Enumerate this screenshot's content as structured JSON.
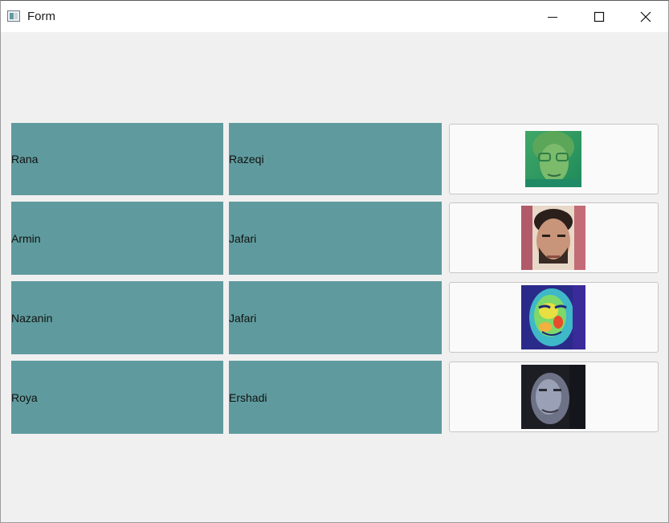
{
  "window": {
    "title": "Form",
    "icon": "app-window-icon",
    "controls": [
      "minimize-icon",
      "maximize-icon",
      "close-icon"
    ]
  },
  "rows": [
    {
      "first_name": "Rana",
      "last_name": "Razeqi",
      "photo_icon": "face-photo-green"
    },
    {
      "first_name": "Armin",
      "last_name": "Jafari",
      "photo_icon": "face-photo-natural"
    },
    {
      "first_name": "Nazanin",
      "last_name": "Jafari",
      "photo_icon": "face-photo-heatmap"
    },
    {
      "first_name": "Roya",
      "last_name": "Ershadi",
      "photo_icon": "face-photo-dark"
    }
  ],
  "colors": {
    "cell_background": "#5f9b9e",
    "window_background": "#f0f0f0",
    "button_background": "#fafafa"
  }
}
